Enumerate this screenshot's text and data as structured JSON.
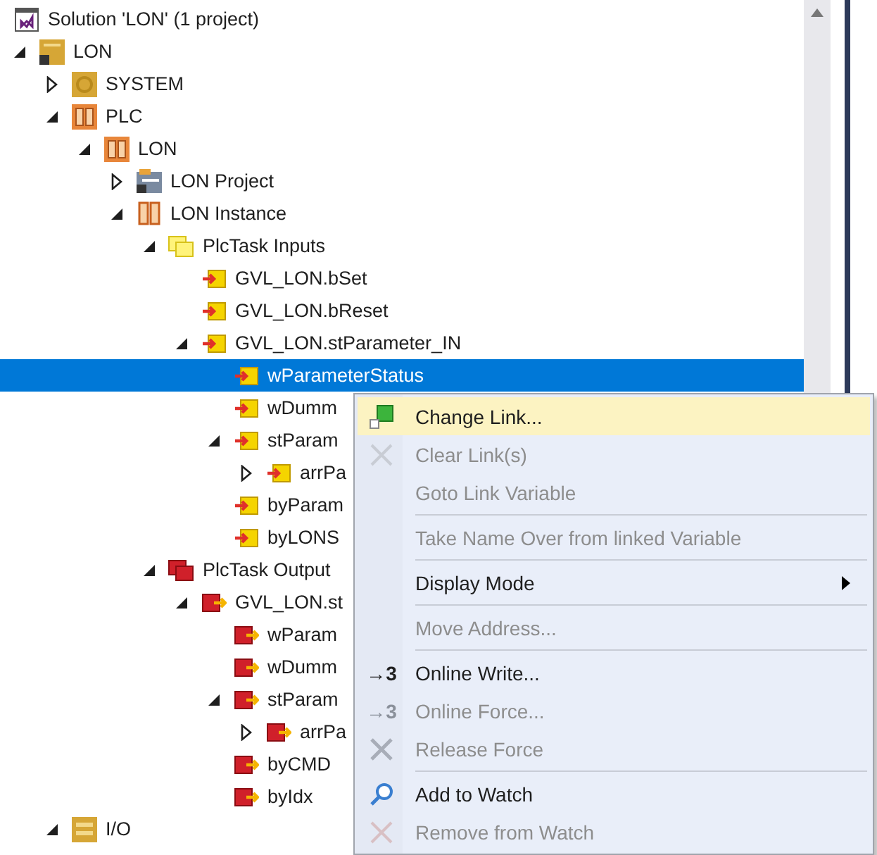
{
  "tree": {
    "label": "Solution 'LON' (1 project)",
    "kind": "solution",
    "selected": false,
    "children": [
      {
        "label": "LON",
        "kind": "project",
        "expanded": true,
        "selected": false,
        "children": [
          {
            "label": "SYSTEM",
            "kind": "system",
            "expanded": false,
            "selected": false
          },
          {
            "label": "PLC",
            "kind": "plc",
            "expanded": true,
            "selected": false,
            "children": [
              {
                "label": "LON",
                "kind": "plc",
                "expanded": true,
                "selected": false,
                "children": [
                  {
                    "label": "LON Project",
                    "kind": "plc-project",
                    "expanded": false,
                    "selected": false
                  },
                  {
                    "label": "LON Instance",
                    "kind": "instance",
                    "expanded": true,
                    "selected": false,
                    "children": [
                      {
                        "label": "PlcTask Inputs",
                        "kind": "task-in",
                        "expanded": true,
                        "selected": false,
                        "children": [
                          {
                            "label": "GVL_LON.bSet",
                            "kind": "var-in",
                            "selected": false
                          },
                          {
                            "label": "GVL_LON.bReset",
                            "kind": "var-in",
                            "selected": false
                          },
                          {
                            "label": "GVL_LON.stParameter_IN",
                            "kind": "var-in",
                            "expanded": true,
                            "selected": false,
                            "children": [
                              {
                                "label": "wParameterStatus",
                                "kind": "var-in",
                                "selected": true
                              },
                              {
                                "label": "wDumm",
                                "kind": "var-in",
                                "selected": false
                              },
                              {
                                "label": "stParam",
                                "kind": "var-in",
                                "expanded": true,
                                "selected": false,
                                "children": [
                                  {
                                    "label": "arrPa",
                                    "kind": "var-in",
                                    "expanded": false,
                                    "selected": false
                                  }
                                ]
                              },
                              {
                                "label": "byParam",
                                "kind": "var-in",
                                "selected": false
                              },
                              {
                                "label": "byLONS",
                                "kind": "var-in",
                                "selected": false
                              }
                            ]
                          }
                        ]
                      },
                      {
                        "label": "PlcTask Output",
                        "kind": "task-out",
                        "expanded": true,
                        "selected": false,
                        "children": [
                          {
                            "label": "GVL_LON.st",
                            "kind": "var-out",
                            "expanded": true,
                            "selected": false,
                            "children": [
                              {
                                "label": "wParam",
                                "kind": "var-out",
                                "selected": false
                              },
                              {
                                "label": "wDumm",
                                "kind": "var-out",
                                "selected": false
                              },
                              {
                                "label": "stParam",
                                "kind": "var-out",
                                "expanded": true,
                                "selected": false,
                                "children": [
                                  {
                                    "label": "arrPa",
                                    "kind": "var-out",
                                    "expanded": false,
                                    "selected": false
                                  }
                                ]
                              },
                              {
                                "label": "byCMD",
                                "kind": "var-out",
                                "selected": false
                              },
                              {
                                "label": "byIdx",
                                "kind": "var-out",
                                "selected": false
                              }
                            ]
                          }
                        ]
                      }
                    ]
                  }
                ]
              }
            ]
          },
          {
            "label": "I/O",
            "kind": "io",
            "expanded": true,
            "selected": false
          }
        ]
      }
    ]
  },
  "context_menu": [
    {
      "kind": "item",
      "label": "Change Link...",
      "disabled": false,
      "highlighted": true
    },
    {
      "kind": "item",
      "label": "Clear Link(s)",
      "disabled": true,
      "highlighted": false
    },
    {
      "kind": "item",
      "label": "Goto Link Variable",
      "disabled": true,
      "highlighted": false
    },
    {
      "kind": "separator"
    },
    {
      "kind": "item",
      "label": "Take Name Over from linked Variable",
      "disabled": true,
      "highlighted": false
    },
    {
      "kind": "separator"
    },
    {
      "kind": "item",
      "label": "Display Mode",
      "disabled": false,
      "highlighted": false,
      "submenu": true
    },
    {
      "kind": "separator"
    },
    {
      "kind": "item",
      "label": "Move Address...",
      "disabled": true,
      "highlighted": false
    },
    {
      "kind": "separator"
    },
    {
      "kind": "item",
      "label": "Online Write...",
      "icon_text": "→3",
      "disabled": false,
      "highlighted": false
    },
    {
      "kind": "item",
      "label": "Online Force...",
      "icon_text": "→3",
      "disabled": true,
      "highlighted": false
    },
    {
      "kind": "item",
      "label": "Release Force",
      "disabled": true,
      "highlighted": false
    },
    {
      "kind": "separator"
    },
    {
      "kind": "item",
      "label": "Add to Watch",
      "disabled": false,
      "highlighted": false
    },
    {
      "kind": "item",
      "label": "Remove from Watch",
      "disabled": true,
      "highlighted": false
    }
  ]
}
